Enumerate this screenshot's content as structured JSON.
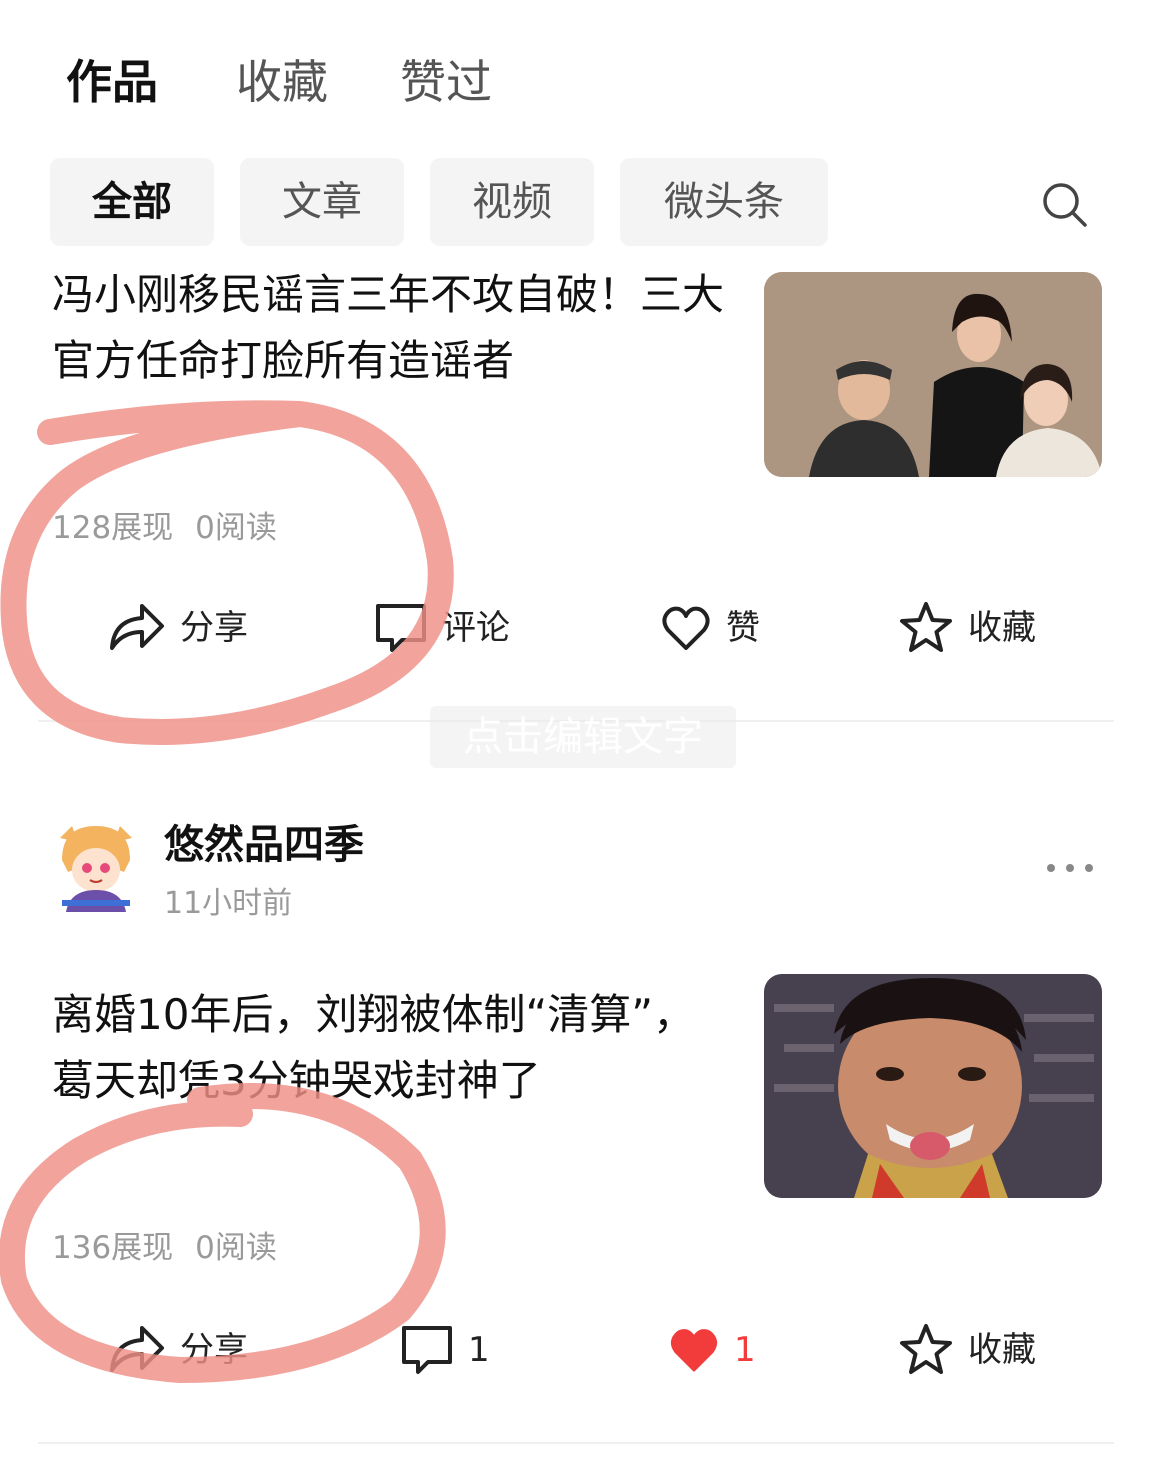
{
  "top_tabs": [
    {
      "label": "作品",
      "active": true
    },
    {
      "label": "收藏",
      "active": false
    },
    {
      "label": "赞过",
      "active": false
    }
  ],
  "filters": [
    {
      "label": "全部",
      "active": true
    },
    {
      "label": "文章",
      "active": false
    },
    {
      "label": "视频",
      "active": false
    },
    {
      "label": "微头条",
      "active": false
    }
  ],
  "search_icon": "search-icon",
  "articles": [
    {
      "title": "冯小刚移民谣言三年不攻自破！三大官方任命打脸所有造谣者",
      "impressions": "128展现",
      "reads": "0阅读",
      "actions": {
        "share": "分享",
        "comment": "评论",
        "like": "赞",
        "favorite": "收藏"
      },
      "liked": false
    },
    {
      "title": "离婚10年后，刘翔被体制“清算”，葛天却凭3分钟哭戏封神了",
      "impressions": "136展现",
      "reads": "0阅读",
      "actions": {
        "share": "分享",
        "comment": "1",
        "like": "1",
        "favorite": "收藏"
      },
      "liked": true
    }
  ],
  "watermark": "点击编辑文字",
  "author": {
    "name": "悠然品四季",
    "time": "11小时前"
  },
  "colors": {
    "like_red": "#f23b3b",
    "annotation_circle": "#ee8f86",
    "muted_text": "#9a9a9a"
  }
}
